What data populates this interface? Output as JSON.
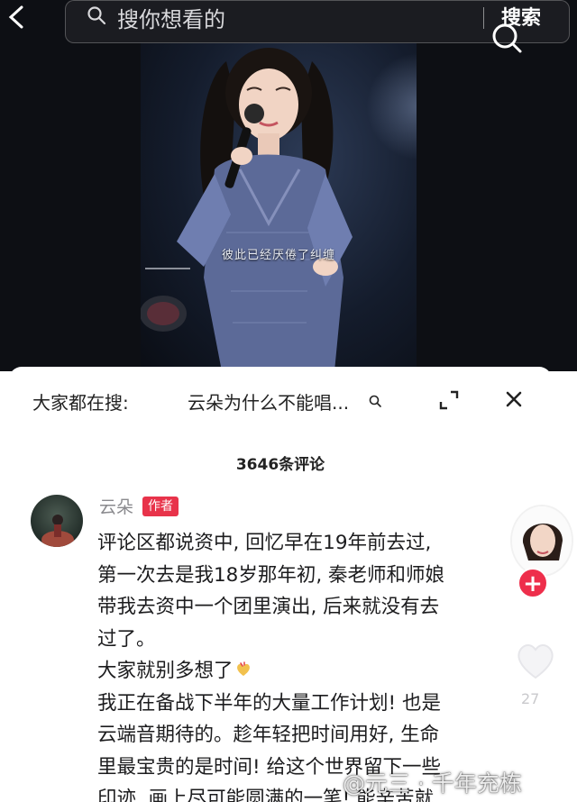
{
  "top_bar": {
    "search_placeholder": "搜你想看的",
    "search_button": "搜索"
  },
  "video": {
    "caption": "彼此已经厌倦了纠缠"
  },
  "comments_sheet": {
    "hot_search_label": "大家都在搜:",
    "hot_search_query": "云朵为什么不能唱...",
    "comment_count": "3646条评论",
    "comment": {
      "author": "云朵",
      "badge": "作者",
      "lines": [
        "评论区都说资中, 回忆早在19年前去过,",
        "第一次去是我18岁那年初, 秦老师和师娘",
        "带我去资中一个团里演出, 后来就没有去",
        "过了。",
        "大家就别多想了",
        "我正在备战下半年的大量工作计划! 也是",
        "云端音期待的。趁年轻把时间用好, 生命",
        "里最宝贵的是时间! 给这个世界留下一些",
        "印迹, 画上尽可能圆满的一笔! 能辛苦就"
      ],
      "emoji": "heart-hand-emoji"
    },
    "like_count": "27"
  },
  "watermark": "@元三 · 千年充栋",
  "colors": {
    "badge": "#e8334a",
    "follow": "#ee2e4b",
    "sheet_bg": "#ffffff",
    "video_bg": "#0d0f14"
  }
}
